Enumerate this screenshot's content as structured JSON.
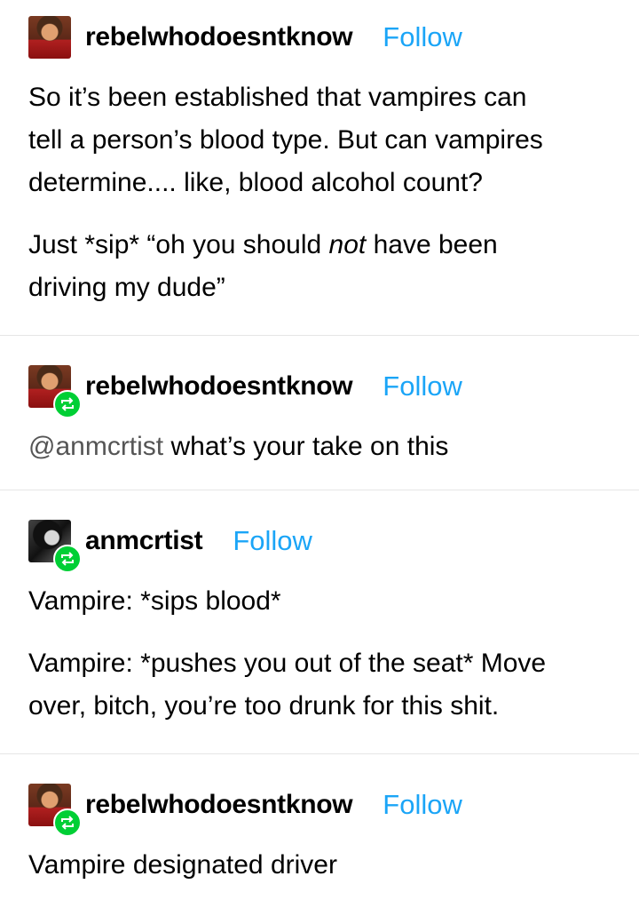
{
  "posts": [
    {
      "username": "rebelwhodoesntknow",
      "follow_label": "Follow",
      "paragraphs": [
        "So it’s been established that vampires can",
        "tell a person’s blood type. But can vampires",
        "determine.... like, blood alcohol count?"
      ],
      "p2_before": "Just *sip* “oh you should ",
      "p2_emph": "not",
      "p2_after": " have been",
      "p2_line2": "driving my dude”"
    },
    {
      "username": "rebelwhodoesntknow",
      "follow_label": "Follow",
      "mention": "@anmcrtist",
      "text": " what’s your take on this"
    },
    {
      "username": "anmcrtist",
      "follow_label": "Follow",
      "line1": "Vampire: *sips blood*",
      "line2": "Vampire: *pushes you out of the seat* Move",
      "line3": "over, bitch, you’re too drunk for this shit."
    },
    {
      "username": "rebelwhodoesntknow",
      "follow_label": "Follow",
      "text": "Vampire designated driver"
    }
  ],
  "colors": {
    "follow": "#1ba5f7",
    "reblog_badge": "#00cf35",
    "mention": "#555555",
    "divider": "#e6e6e6"
  },
  "icons": {
    "reblog": "reblog-icon"
  }
}
